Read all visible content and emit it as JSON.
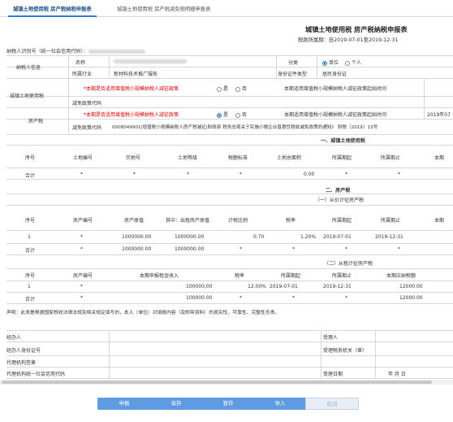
{
  "tabs": [
    {
      "label": "城镇土地使用税 房产税纳税申报表"
    },
    {
      "label": "城镇土地使用税 房产税减免税明细申报表"
    }
  ],
  "title": "城镇土地使用税 房产税纳税申报表",
  "period": "税款所属期：自2019-07-01至2019-12-31",
  "taxpayer": {
    "label": "纳税人识别号（统一社会信用代码）："
  },
  "info": {
    "section": "纳税人信息",
    "name_label": "名称",
    "category_label": "分类",
    "opt1": "单位",
    "opt2": "个人",
    "industry_label": "所属行业",
    "industry_value": "新材料技术推广服务",
    "idtype_label": "身份证件类型",
    "idtype_value": "居民身份证"
  },
  "land": {
    "section": "城镇土地使用税",
    "q": "*本期是否适用增值税小规模纳税人减征政策",
    "yes": "是",
    "no": "否",
    "start": "本期适用增值税小规模纳税人减征政策起始时间",
    "code_label": "减免政策代码"
  },
  "prop": {
    "section": "房产税",
    "q": "*本期是否适用增值税小规模纳税人减征政策",
    "yes": "是",
    "no": "否",
    "start": "本期适用增值税小规模纳税人减征政策起始时间",
    "start_value": "2019年07",
    "code_label": "减免政策代码",
    "code_value": "0008049901|增值税小规模纳税人房产税减征|财政部 税务总局关于实施小微企业普惠性税收减免政策的通知》 财税〔2019〕13号"
  },
  "s1": {
    "title": "一、城镇土地使用税",
    "headers": [
      "序号",
      "土地编号",
      "宗地号",
      "土地等级",
      "税额标准",
      "土地总面积",
      "所属期起",
      "所属期止",
      "本期"
    ],
    "total": [
      "合计",
      "*",
      "*",
      "*",
      "*",
      "0.00",
      "*",
      "*"
    ]
  },
  "s2": {
    "title": "二、房产税"
  },
  "s2a": {
    "title": "（一）从价计征房产税",
    "headers": [
      "序号",
      "房产编号",
      "房产原值",
      "其中：出租房产原值",
      "计税比例",
      "税率",
      "所属期起",
      "所属期止",
      "本期"
    ],
    "row": [
      "1",
      "*",
      "1000000.00",
      "1000000.00",
      "0.70",
      "1.20%",
      "2019-07-01",
      "2019-12-31"
    ],
    "total": [
      "合计",
      "*",
      "1000000.00",
      "1000000.00",
      "*",
      "*",
      "*",
      "*"
    ]
  },
  "s2b": {
    "title": "（二）从租计征房产税",
    "headers": [
      "序号",
      "房产编号",
      "本期申报租金收入",
      "税率",
      "所属期起",
      "所属期止",
      "本期应纳税额"
    ],
    "row": [
      "1",
      "*",
      "100000.00",
      "12.00%",
      "2019-07-01",
      "2019-12-31",
      "12000.00"
    ],
    "total": [
      "合计",
      "*",
      "100000.00",
      "*",
      "*",
      "*",
      "12000.00"
    ]
  },
  "declare": "声明：此表是根据国家税收法律法规及相关规定填写的，本人（单位）对填报内容（及附带资料）的真实性、可靠性、完整性负责。",
  "sign": {
    "handler": "经办人",
    "handler_id": "经办人身份证号",
    "agent": "代理机构签章",
    "agent_code": "代理机构统一社会信用代码",
    "receiver": "受理人",
    "receiver_org": "受理税务机关（章）",
    "receive_date": "受理日期",
    "ymd": "年    月    日"
  },
  "buttons": {
    "b1": "申报",
    "b2": "保存",
    "b3": "暂存",
    "b4": "导入",
    "b5": "取消"
  },
  "colors": {
    "accent": "#2d7dd2",
    "button": "#5f9be0",
    "required": "#dd0000"
  }
}
